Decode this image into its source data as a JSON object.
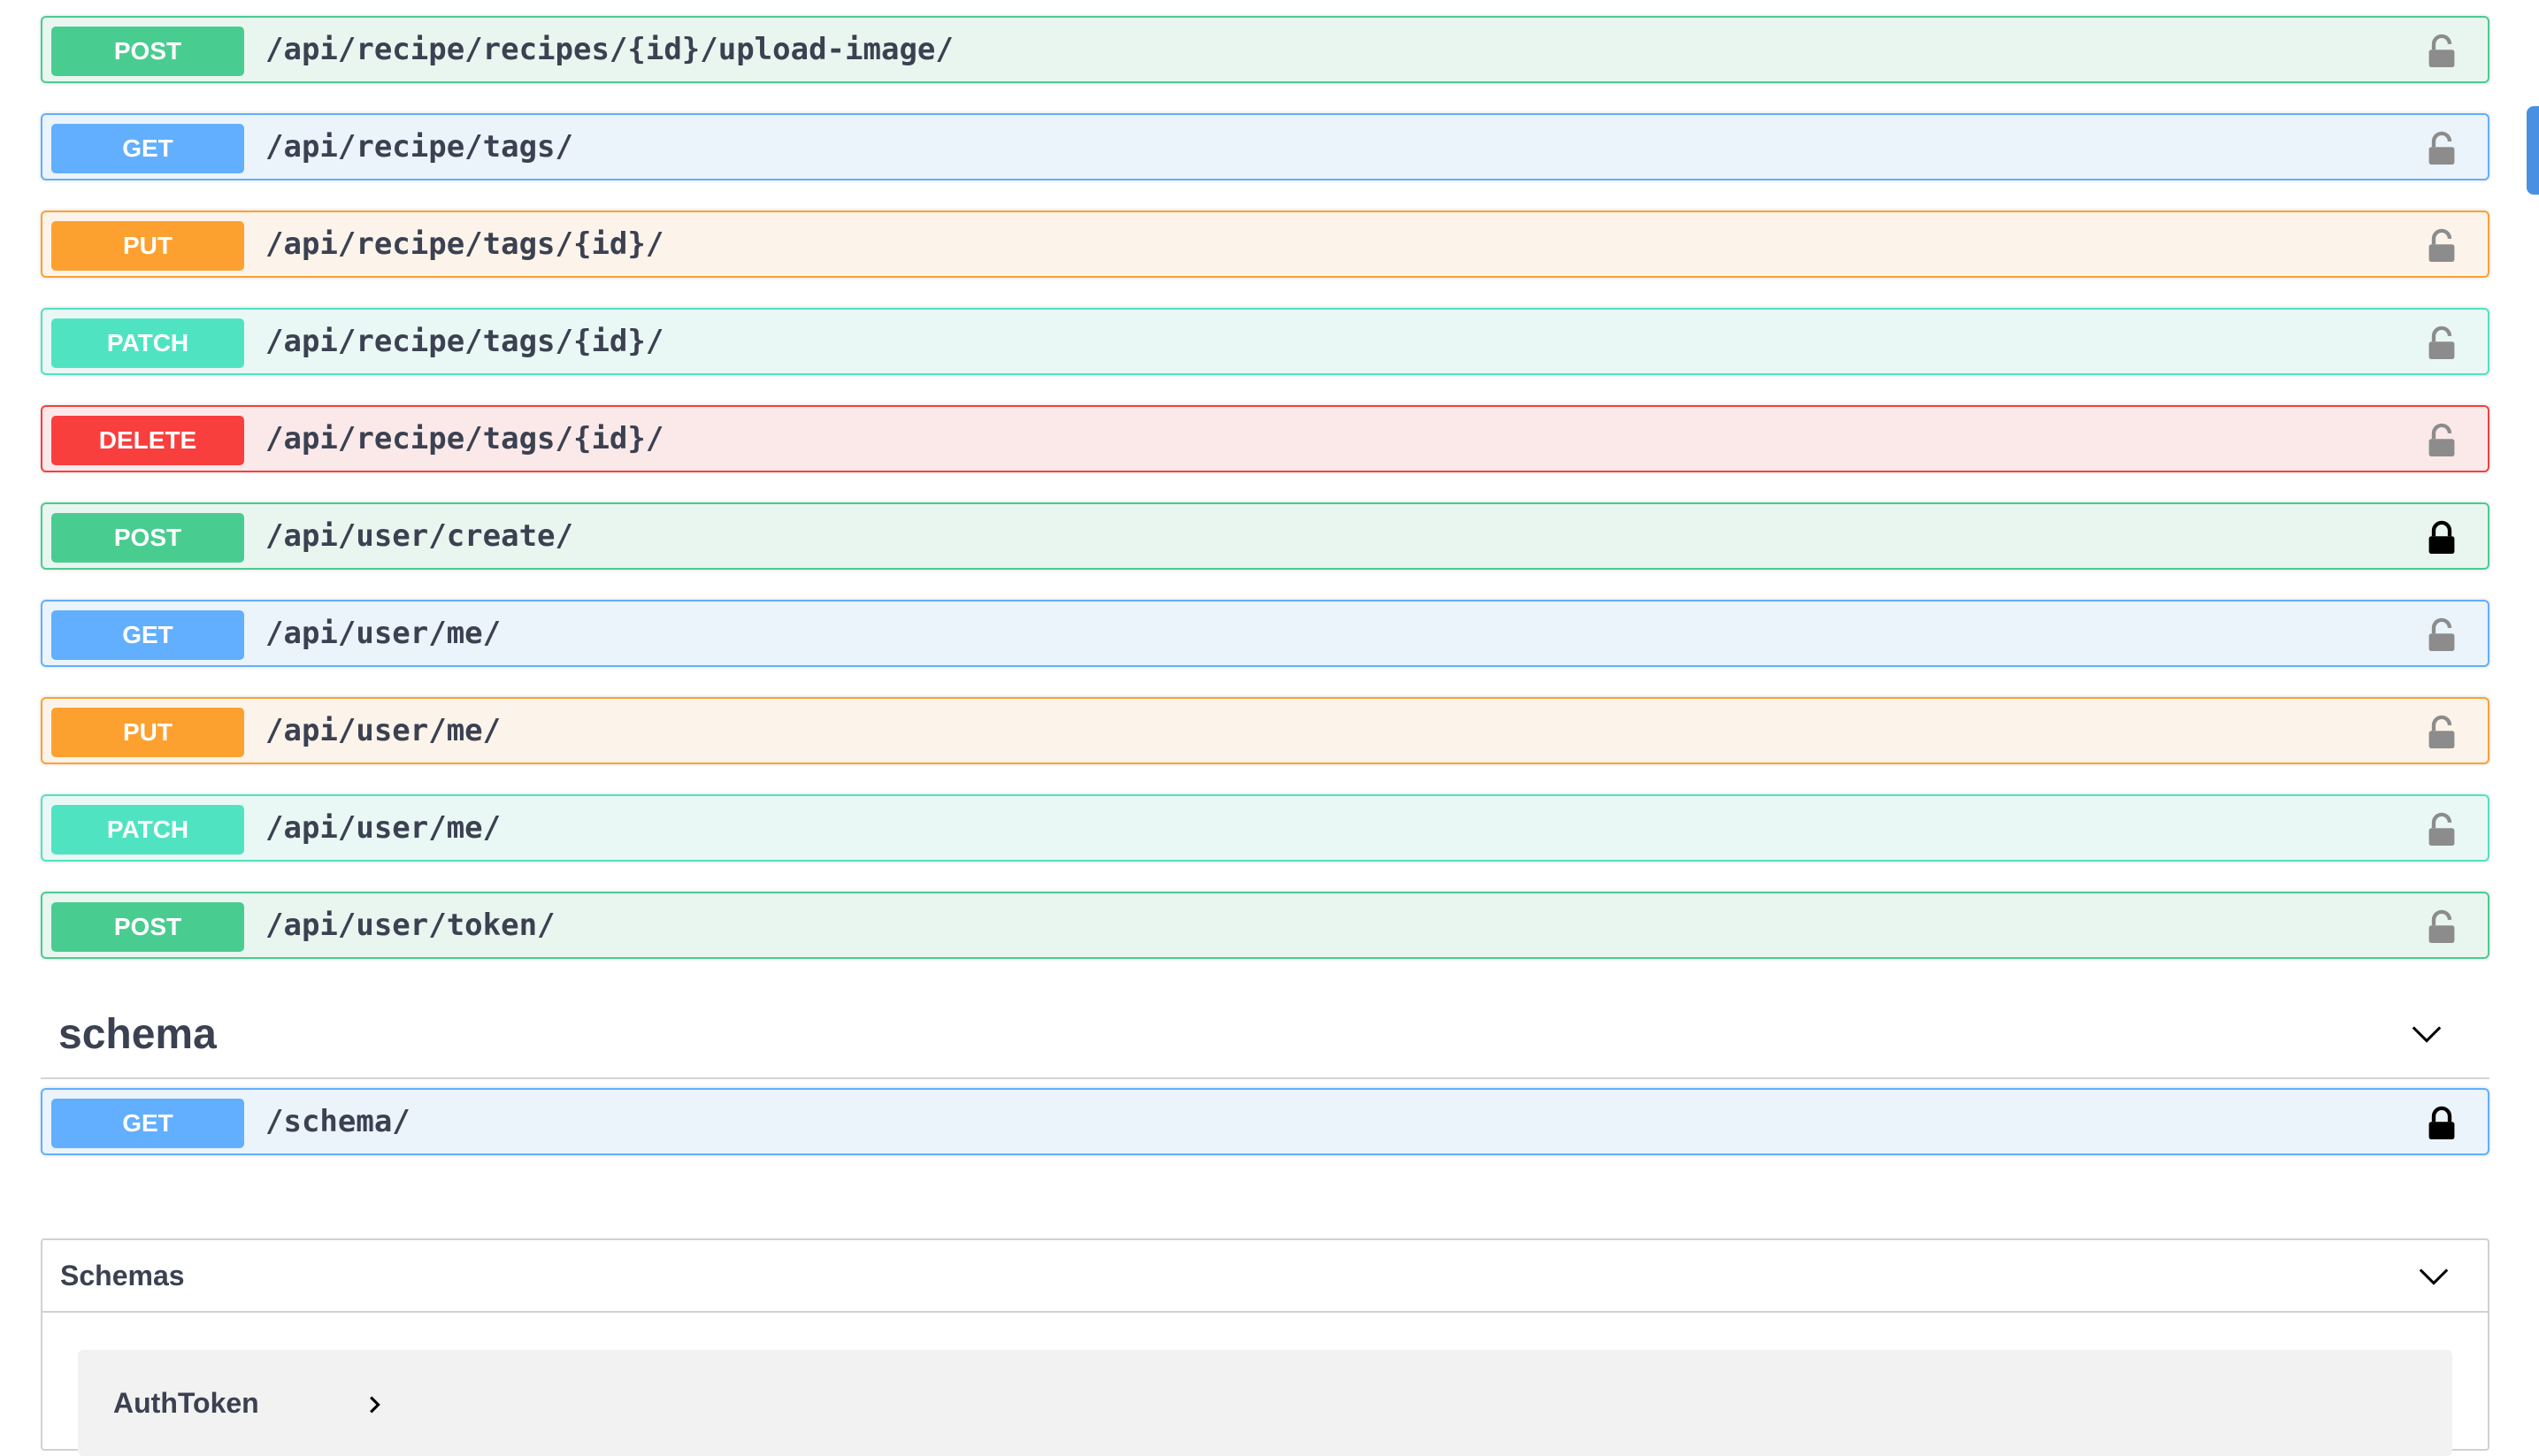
{
  "operations": [
    {
      "method": "POST",
      "path": "/api/recipe/recipes/{id}/upload-image/",
      "lock": "unlocked"
    },
    {
      "method": "GET",
      "path": "/api/recipe/tags/",
      "lock": "unlocked"
    },
    {
      "method": "PUT",
      "path": "/api/recipe/tags/{id}/",
      "lock": "unlocked"
    },
    {
      "method": "PATCH",
      "path": "/api/recipe/tags/{id}/",
      "lock": "unlocked"
    },
    {
      "method": "DELETE",
      "path": "/api/recipe/tags/{id}/",
      "lock": "unlocked"
    },
    {
      "method": "POST",
      "path": "/api/user/create/",
      "lock": "locked"
    },
    {
      "method": "GET",
      "path": "/api/user/me/",
      "lock": "unlocked"
    },
    {
      "method": "PUT",
      "path": "/api/user/me/",
      "lock": "unlocked"
    },
    {
      "method": "PATCH",
      "path": "/api/user/me/",
      "lock": "unlocked"
    },
    {
      "method": "POST",
      "path": "/api/user/token/",
      "lock": "unlocked"
    }
  ],
  "schema_section": {
    "title": "schema",
    "operations": [
      {
        "method": "GET",
        "path": "/schema/",
        "lock": "locked"
      }
    ]
  },
  "models": {
    "title": "Schemas",
    "items": [
      {
        "name": "AuthToken"
      }
    ]
  },
  "colors": {
    "post": "#49cc90",
    "get": "#61affe",
    "put": "#fca130",
    "patch": "#50e3c2",
    "delete": "#f93e3e",
    "lock_unlocked": "#8c8c8c",
    "lock_locked": "#000000",
    "scrollbar": "#4990e2"
  },
  "icons": {
    "lock_unlocked": "lock-open-icon",
    "lock_locked": "lock-closed-icon",
    "section_toggle": "chevron-down-icon",
    "model_expand": "chevron-right-icon"
  }
}
